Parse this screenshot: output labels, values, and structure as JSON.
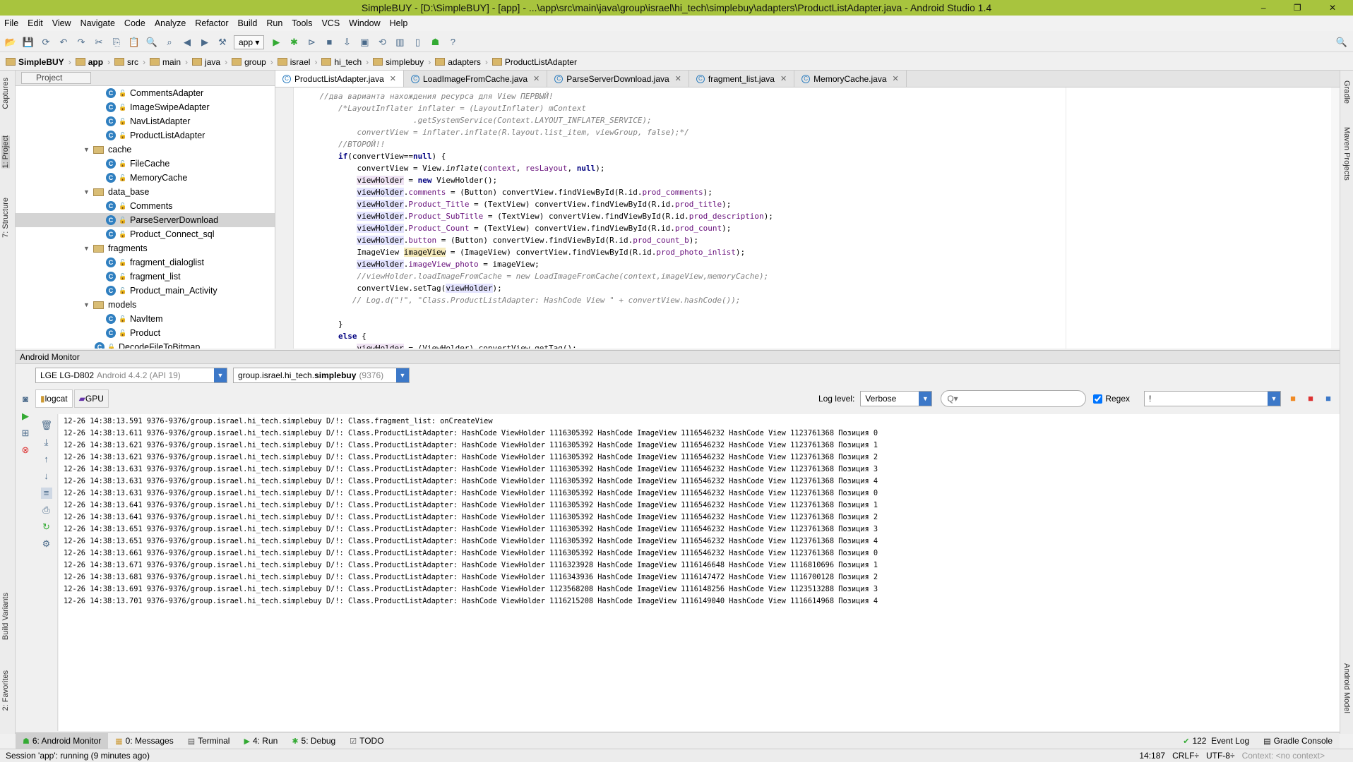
{
  "window": {
    "title": "SimpleBUY - [D:\\SimpleBUY] - [app] - ...\\app\\src\\main\\java\\group\\israel\\hi_tech\\simplebuy\\adapters\\ProductListAdapter.java - Android Studio 1.4",
    "controls": "– ❐ ✕"
  },
  "menu": [
    "File",
    "Edit",
    "View",
    "Navigate",
    "Code",
    "Analyze",
    "Refactor",
    "Build",
    "Run",
    "Tools",
    "VCS",
    "Window",
    "Help"
  ],
  "toolbar": {
    "run_config": "app ▾",
    "icons": [
      "open-icon",
      "save-icon",
      "sync-icon",
      "undo-icon",
      "redo-icon",
      "cut-icon",
      "copy-icon",
      "paste-icon",
      "find-icon",
      "replace-icon",
      "back-icon",
      "forward-icon",
      "make-icon"
    ],
    "icons2": [
      "run-icon",
      "debug-icon",
      "attach-icon",
      "stop-icon",
      "sdk-icon",
      "avd-icon",
      "gradle-sync-icon",
      "monitor-icon",
      "device-icon",
      "android-icon",
      "help-icon"
    ]
  },
  "breadcrumb": [
    "SimpleBUY",
    "app",
    "src",
    "main",
    "java",
    "group",
    "israel",
    "hi_tech",
    "simplebuy",
    "adapters",
    "ProductListAdapter"
  ],
  "left_strip": {
    "captures": "Captures",
    "project": "1: Project",
    "structure": "7: Structure",
    "build_variants": "Build Variants",
    "favorites": "2: Favorites"
  },
  "right_strip": {
    "gradle": "Gradle",
    "maven": "Maven Projects",
    "android_model": "Android Model"
  },
  "project_panel": {
    "view": "Project",
    "tree": [
      {
        "label": "CommentsAdapter",
        "type": "class",
        "level": 3
      },
      {
        "label": "ImageSwipeAdapter",
        "type": "class",
        "level": 3
      },
      {
        "label": "NavListAdapter",
        "type": "class",
        "level": 3
      },
      {
        "label": "ProductListAdapter",
        "type": "class",
        "level": 3
      },
      {
        "label": "cache",
        "type": "folder",
        "level": 2
      },
      {
        "label": "FileCache",
        "type": "class",
        "level": 3
      },
      {
        "label": "MemoryCache",
        "type": "class",
        "level": 3
      },
      {
        "label": "data_base",
        "type": "folder",
        "level": 2
      },
      {
        "label": "Comments",
        "type": "class",
        "level": 3
      },
      {
        "label": "ParseServerDownload",
        "type": "class",
        "level": 3,
        "selected": true
      },
      {
        "label": "Product_Connect_sql",
        "type": "class",
        "level": 3
      },
      {
        "label": "fragments",
        "type": "folder",
        "level": 2
      },
      {
        "label": "fragment_dialoglist",
        "type": "class",
        "level": 3
      },
      {
        "label": "fragment_list",
        "type": "class",
        "level": 3
      },
      {
        "label": "Product_main_Activity",
        "type": "class",
        "level": 3
      },
      {
        "label": "models",
        "type": "folder",
        "level": 2
      },
      {
        "label": "NavItem",
        "type": "class",
        "level": 3
      },
      {
        "label": "Product",
        "type": "class",
        "level": 3
      },
      {
        "label": "DecodeFileToBitmap",
        "type": "class",
        "level": 2
      }
    ]
  },
  "editor_tabs": [
    {
      "label": "ProductListAdapter.java",
      "active": true
    },
    {
      "label": "LoadImageFromCache.java"
    },
    {
      "label": "ParseServerDownload.java"
    },
    {
      "label": "fragment_list.java"
    },
    {
      "label": "MemoryCache.java"
    }
  ],
  "code": [
    [
      {
        "t": "    "
      },
      {
        "t": "//два варианта нахождения ресурса для View ПЕРВЫЙ!",
        "c": "cm"
      }
    ],
    [
      {
        "t": "        "
      },
      {
        "t": "/*LayoutInflater inflater = (LayoutInflater) mContext",
        "c": "cm"
      }
    ],
    [
      {
        "t": "                        "
      },
      {
        "t": ".getSystemService(Context.LAYOUT_INFLATER_SERVICE);",
        "c": "cm"
      }
    ],
    [
      {
        "t": "            "
      },
      {
        "t": "convertView = inflater.inflate(R.layout.list_item, viewGroup, false);*/",
        "c": "cm"
      }
    ],
    [
      {
        "t": "        "
      },
      {
        "t": "//ВТОРОЙ!!",
        "c": "cm"
      }
    ],
    [
      {
        "t": "        "
      },
      {
        "t": "if",
        "c": "kw"
      },
      {
        "t": "(convertView=="
      },
      {
        "t": "null",
        "c": "kw"
      },
      {
        "t": ") {"
      }
    ],
    [
      {
        "t": "            convertView = View."
      },
      {
        "t": "inflate",
        "c": "it"
      },
      {
        "t": "("
      },
      {
        "t": "context",
        "c": "fld"
      },
      {
        "t": ", "
      },
      {
        "t": "resLayout",
        "c": "fld"
      },
      {
        "t": ", "
      },
      {
        "t": "null",
        "c": "kw"
      },
      {
        "t": ");"
      }
    ],
    [
      {
        "t": "            "
      },
      {
        "t": "viewHolder",
        "c": "hlv"
      },
      {
        "t": " = "
      },
      {
        "t": "new",
        "c": "kw"
      },
      {
        "t": " ViewHolder();"
      }
    ],
    [
      {
        "t": "            "
      },
      {
        "t": "viewHolder",
        "c": "hlb"
      },
      {
        "t": "."
      },
      {
        "t": "comments",
        "c": "fld"
      },
      {
        "t": " = (Button) convertView.findViewById(R.id."
      },
      {
        "t": "prod_comments",
        "c": "fld"
      },
      {
        "t": ");"
      }
    ],
    [
      {
        "t": "            "
      },
      {
        "t": "viewHolder",
        "c": "hlb"
      },
      {
        "t": "."
      },
      {
        "t": "Product_Title",
        "c": "fld"
      },
      {
        "t": " = (TextView) convertView.findViewById(R.id."
      },
      {
        "t": "prod_title",
        "c": "fld"
      },
      {
        "t": ");"
      }
    ],
    [
      {
        "t": "            "
      },
      {
        "t": "viewHolder",
        "c": "hlb"
      },
      {
        "t": "."
      },
      {
        "t": "Product_SubTitle",
        "c": "fld"
      },
      {
        "t": " = (TextView) convertView.findViewById(R.id."
      },
      {
        "t": "prod_description",
        "c": "fld"
      },
      {
        "t": ");"
      }
    ],
    [
      {
        "t": "            "
      },
      {
        "t": "viewHolder",
        "c": "hlb"
      },
      {
        "t": "."
      },
      {
        "t": "Product_Count",
        "c": "fld"
      },
      {
        "t": " = (TextView) convertView.findViewById(R.id."
      },
      {
        "t": "prod_count",
        "c": "fld"
      },
      {
        "t": ");"
      }
    ],
    [
      {
        "t": "            "
      },
      {
        "t": "viewHolder",
        "c": "hlb"
      },
      {
        "t": "."
      },
      {
        "t": "button",
        "c": "fld"
      },
      {
        "t": " = (Button) convertView.findViewById(R.id."
      },
      {
        "t": "prod_count_b",
        "c": "fld"
      },
      {
        "t": ");"
      }
    ],
    [
      {
        "t": "            ImageView "
      },
      {
        "t": "imageView",
        "c": "hly"
      },
      {
        "t": " = (ImageView) convertView.findViewById(R.id."
      },
      {
        "t": "prod_photo_inlist",
        "c": "fld"
      },
      {
        "t": ");"
      }
    ],
    [
      {
        "t": "            "
      },
      {
        "t": "viewHolder",
        "c": "hlb"
      },
      {
        "t": "."
      },
      {
        "t": "imageView_photo",
        "c": "fld"
      },
      {
        "t": " = imageView;"
      }
    ],
    [
      {
        "t": "            "
      },
      {
        "t": "//viewHolder.loadImageFromCache = new LoadImageFromCache(context,imageView,memoryCache);",
        "c": "cm"
      }
    ],
    [
      {
        "t": "            convertView.setTag("
      },
      {
        "t": "viewHolder",
        "c": "hlb"
      },
      {
        "t": ");"
      }
    ],
    [
      {
        "t": "           "
      },
      {
        "t": "// Log.d(\"!\", \"Class.ProductListAdapter: HashCode View \" + convertView.hashCode());",
        "c": "cm"
      }
    ],
    [
      {
        "t": ""
      }
    ],
    [
      {
        "t": "        }"
      }
    ],
    [
      {
        "t": "        "
      },
      {
        "t": "else",
        "c": "kw"
      },
      {
        "t": " {"
      }
    ],
    [
      {
        "t": "            "
      },
      {
        "t": "viewHolder",
        "c": "hlv"
      },
      {
        "t": " = (ViewHolder) convertView.getTag();"
      }
    ]
  ],
  "monitor": {
    "title": "Android Monitor",
    "device": "LGE LG-D802",
    "device_os": "Android 4.4.2 (API 19)",
    "process": "group.israel.hi_tech.",
    "process_bold": "simplebuy",
    "process_pid": "(9376)",
    "tabs": [
      {
        "label": "logcat",
        "active": true
      },
      {
        "label": "GPU"
      }
    ],
    "log_level_label": "Log level:",
    "log_level": "Verbose",
    "search_placeholder": "Q▾",
    "regex_label": "Regex",
    "regex_checked": true,
    "filter": "!",
    "log": [
      "12-26 14:38:13.591 9376-9376/group.israel.hi_tech.simplebuy D/!: Class.fragment_list: onCreateView",
      "12-26 14:38:13.611 9376-9376/group.israel.hi_tech.simplebuy D/!: Class.ProductListAdapter: HashCode ViewHolder 1116305392 HashCode ImageView 1116546232 HashCode View 1123761368 Позиция 0",
      "12-26 14:38:13.621 9376-9376/group.israel.hi_tech.simplebuy D/!: Class.ProductListAdapter: HashCode ViewHolder 1116305392 HashCode ImageView 1116546232 HashCode View 1123761368 Позиция 1",
      "12-26 14:38:13.621 9376-9376/group.israel.hi_tech.simplebuy D/!: Class.ProductListAdapter: HashCode ViewHolder 1116305392 HashCode ImageView 1116546232 HashCode View 1123761368 Позиция 2",
      "12-26 14:38:13.631 9376-9376/group.israel.hi_tech.simplebuy D/!: Class.ProductListAdapter: HashCode ViewHolder 1116305392 HashCode ImageView 1116546232 HashCode View 1123761368 Позиция 3",
      "12-26 14:38:13.631 9376-9376/group.israel.hi_tech.simplebuy D/!: Class.ProductListAdapter: HashCode ViewHolder 1116305392 HashCode ImageView 1116546232 HashCode View 1123761368 Позиция 4",
      "12-26 14:38:13.631 9376-9376/group.israel.hi_tech.simplebuy D/!: Class.ProductListAdapter: HashCode ViewHolder 1116305392 HashCode ImageView 1116546232 HashCode View 1123761368 Позиция 0",
      "12-26 14:38:13.641 9376-9376/group.israel.hi_tech.simplebuy D/!: Class.ProductListAdapter: HashCode ViewHolder 1116305392 HashCode ImageView 1116546232 HashCode View 1123761368 Позиция 1",
      "12-26 14:38:13.641 9376-9376/group.israel.hi_tech.simplebuy D/!: Class.ProductListAdapter: HashCode ViewHolder 1116305392 HashCode ImageView 1116546232 HashCode View 1123761368 Позиция 2",
      "12-26 14:38:13.651 9376-9376/group.israel.hi_tech.simplebuy D/!: Class.ProductListAdapter: HashCode ViewHolder 1116305392 HashCode ImageView 1116546232 HashCode View 1123761368 Позиция 3",
      "12-26 14:38:13.651 9376-9376/group.israel.hi_tech.simplebuy D/!: Class.ProductListAdapter: HashCode ViewHolder 1116305392 HashCode ImageView 1116546232 HashCode View 1123761368 Позиция 4",
      "12-26 14:38:13.661 9376-9376/group.israel.hi_tech.simplebuy D/!: Class.ProductListAdapter: HashCode ViewHolder 1116305392 HashCode ImageView 1116546232 HashCode View 1123761368 Позиция 0",
      "12-26 14:38:13.671 9376-9376/group.israel.hi_tech.simplebuy D/!: Class.ProductListAdapter: HashCode ViewHolder 1116323928 HashCode ImageView 1116146648 HashCode View 1116810696 Позиция 1",
      "12-26 14:38:13.681 9376-9376/group.israel.hi_tech.simplebuy D/!: Class.ProductListAdapter: HashCode ViewHolder 1116343936 HashCode ImageView 1116147472 HashCode View 1116700128 Позиция 2",
      "12-26 14:38:13.691 9376-9376/group.israel.hi_tech.simplebuy D/!: Class.ProductListAdapter: HashCode ViewHolder 1123568208 HashCode ImageView 1116148256 HashCode View 1123513288 Позиция 3",
      "12-26 14:38:13.701 9376-9376/group.israel.hi_tech.simplebuy D/!: Class.ProductListAdapter: HashCode ViewHolder 1116215208 HashCode ImageView 1116149040 HashCode View 1116614968 Позиция 4"
    ]
  },
  "bottom_tabs": [
    {
      "label": "6: Android Monitor",
      "icon": "android-icon",
      "active": true
    },
    {
      "label": "0: Messages",
      "icon": "messages-icon"
    },
    {
      "label": "Terminal",
      "icon": "terminal-icon"
    },
    {
      "label": "4: Run",
      "icon": "run-icon"
    },
    {
      "label": "5: Debug",
      "icon": "debug-icon"
    },
    {
      "label": "TODO",
      "icon": "todo-icon"
    }
  ],
  "bottom_right": {
    "event_log_count": "122",
    "event_log": "Event Log",
    "gradle_console": "Gradle Console"
  },
  "status": {
    "message": "Session 'app': running (9 minutes ago)",
    "position": "14:187",
    "line_sep": "CRLF÷",
    "encoding": "UTF-8÷",
    "context": "Context: <no context>"
  },
  "colors": {
    "title_bar": "#a8c43e",
    "accent": "#3c78c8",
    "selection": "#d4d4d4"
  }
}
